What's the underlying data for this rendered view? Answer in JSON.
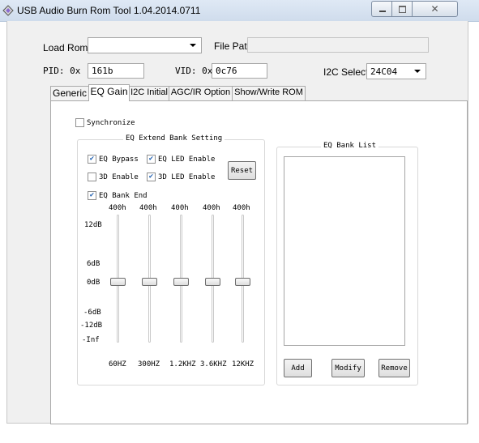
{
  "window": {
    "title": "USB Audio Burn Rom Tool 1.04.2014.0711"
  },
  "top": {
    "load_rom_label": "Load Rom",
    "load_rom_value": "",
    "file_path_label": "File Path:",
    "file_path_value": "",
    "pid_label": "PID: 0x",
    "pid_value": "161b",
    "vid_label": "VID: 0x",
    "vid_value": "0c76",
    "i2c_select_label": "I2C Select",
    "i2c_select_value": "24C04"
  },
  "tabs": [
    "Generic",
    "EQ Gain",
    "I2C Initial",
    "AGC/IR Option",
    "Show/Write ROM"
  ],
  "active_tab": "EQ Gain",
  "eq": {
    "synchronize_label": "Synchronize",
    "synchronize_checked": false,
    "group_title": "EQ Extend Bank Setting",
    "checkboxes": [
      {
        "label": "EQ Bypass",
        "checked": true
      },
      {
        "label": "EQ LED Enable",
        "checked": true
      },
      {
        "label": "3D Enable",
        "checked": false
      },
      {
        "label": "3D LED Enable",
        "checked": true
      },
      {
        "label": "EQ Bank End",
        "checked": true
      }
    ],
    "reset_label": "Reset",
    "band_values": [
      "400h",
      "400h",
      "400h",
      "400h",
      "400h"
    ],
    "band_freqs": [
      "60HZ",
      "300HZ",
      "1.2KHZ",
      "3.6KHZ",
      "12KHZ"
    ],
    "scale": [
      "12dB",
      "6dB",
      "0dB",
      "-6dB",
      "-12dB",
      "-Inf"
    ],
    "slider_levels_db": [
      0,
      0,
      0,
      0,
      0
    ]
  },
  "bank_list": {
    "title": "EQ Bank List",
    "items": [],
    "add_label": "Add",
    "modify_label": "Modify",
    "remove_label": "Remove"
  },
  "colors": {
    "checkmark": "#1f5fb0",
    "titlebar": "#dfe9f5"
  }
}
